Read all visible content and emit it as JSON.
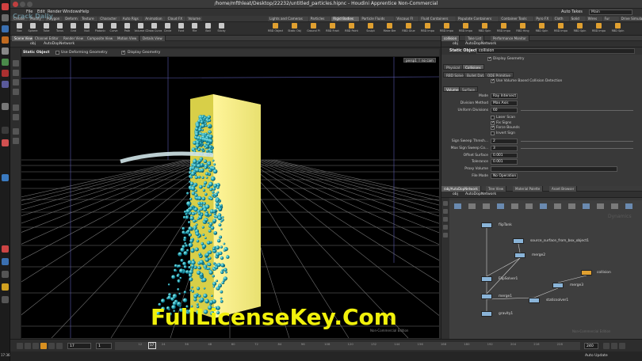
{
  "window": {
    "title": "/home/mfthleat/Desktop/22232/untitled_particles.hipnc - Houdini Apprentice Non-Commercial"
  },
  "menu": [
    "File",
    "Edit",
    "Render",
    "Windows",
    "Help"
  ],
  "desktop_switch": {
    "label": "Auto Takes",
    "value": "Main"
  },
  "shelf_tabs": [
    {
      "label": "Create",
      "active": false
    },
    {
      "label": "Modify",
      "active": false
    },
    {
      "label": "Polygon",
      "active": false
    },
    {
      "label": "Deform",
      "active": false
    },
    {
      "label": "Texture",
      "active": false
    },
    {
      "label": "Character",
      "active": false
    },
    {
      "label": "Auto Rigs",
      "active": false
    },
    {
      "label": "Animation",
      "active": false
    },
    {
      "label": "Cloud FX",
      "active": false
    },
    {
      "label": "Volume",
      "active": false
    },
    {
      "label": "Lights and Cameras",
      "active": false
    },
    {
      "label": "Particles",
      "active": false
    },
    {
      "label": "Rigid Bodies",
      "active": true
    },
    {
      "label": "Particle Fluids",
      "active": false
    },
    {
      "label": "Viscous Fl",
      "active": false
    },
    {
      "label": "Fluid Containers",
      "active": false
    },
    {
      "label": "Populate Containers",
      "active": false
    },
    {
      "label": "Container Tools",
      "active": false
    },
    {
      "label": "Pyro FX",
      "active": false
    },
    {
      "label": "Cloth",
      "active": false
    },
    {
      "label": "Solid",
      "active": false
    },
    {
      "label": "Wires",
      "active": false
    },
    {
      "label": "Fur",
      "active": false
    },
    {
      "label": "Drive Simulation",
      "active": false
    }
  ],
  "shelf_tools": [
    {
      "label": "Box",
      "color": "#c9c9c9"
    },
    {
      "label": "Sphere",
      "color": "#c9c9c9"
    },
    {
      "label": "Tube",
      "color": "#c9c9c9"
    },
    {
      "label": "Torus",
      "color": "#c9c9c9"
    },
    {
      "label": "Grid",
      "color": "#c9c9c9"
    },
    {
      "label": "Null",
      "color": "#c9c9c9"
    },
    {
      "label": "Platonic",
      "color": "#c9c9c9"
    },
    {
      "label": "Curve",
      "color": "#c9c9c9"
    },
    {
      "label": "Path",
      "color": "#c9c9c9"
    },
    {
      "label": "Volume C",
      "color": "#c9c9c9"
    },
    {
      "label": "Draw Curve",
      "color": "#c9c9c9"
    },
    {
      "label": "Circle",
      "color": "#c9c9c9"
    },
    {
      "label": "Font",
      "color": "#c9c9c9"
    },
    {
      "label": "File",
      "color": "#c9c9c9"
    },
    {
      "label": "Ball",
      "color": "#c9c9c9"
    },
    {
      "label": "Sticky",
      "color": "#c9c9c9"
    },
    {
      "label": "RBD Object",
      "color": "#e0a030"
    },
    {
      "label": "Static Obj",
      "color": "#e0a030"
    },
    {
      "label": "Ground Pl",
      "color": "#e0a030"
    },
    {
      "label": "RBD Fract",
      "color": "#e0a030"
    },
    {
      "label": "RBD Point",
      "color": "#e0a030"
    },
    {
      "label": "Sculpt",
      "color": "#e0a030"
    },
    {
      "label": "Make Bre",
      "color": "#e0a030"
    },
    {
      "label": "RBD Glue",
      "color": "#e0a030"
    },
    {
      "label": "RBD Impo",
      "color": "#e0a030"
    },
    {
      "label": "RBD Impo",
      "color": "#e0a030"
    },
    {
      "label": "RBD Impo",
      "color": "#e0a030"
    },
    {
      "label": "RBD Spin",
      "color": "#e0a030"
    },
    {
      "label": "RBD Impo",
      "color": "#e0a030"
    },
    {
      "label": "RBD Hing",
      "color": "#e0a030"
    },
    {
      "label": "RBD Spin",
      "color": "#e0a030"
    },
    {
      "label": "RBD Impo",
      "color": "#e0a030"
    },
    {
      "label": "RBD Spin",
      "color": "#e0a030"
    },
    {
      "label": "RBD Impo",
      "color": "#e0a030"
    },
    {
      "label": "RBD Spin",
      "color": "#e0a030"
    }
  ],
  "left_pane": {
    "tabs": [
      {
        "label": "Scene View",
        "active": true
      },
      {
        "label": "Channel Editor",
        "active": false
      },
      {
        "label": "Render View",
        "active": false
      },
      {
        "label": "Composite View",
        "active": false
      },
      {
        "label": "Motion View",
        "active": false
      },
      {
        "label": "Details View",
        "active": false
      }
    ],
    "path": "obj",
    "network": "AutoDopNetwork",
    "viewport_bar": {
      "object_type": "Static Object",
      "deforming": "Use Deforming Geometry",
      "display": "Display Geometry"
    },
    "view_labels": {
      "persp": "persp1",
      "cam": "no cam"
    },
    "corner_label": "Non-Commercial Edition"
  },
  "param_pane": {
    "tabs": [
      {
        "label": "collision",
        "active": true
      },
      {
        "label": "Take List",
        "active": false
      },
      {
        "label": "Performance Monitor",
        "active": false
      }
    ],
    "node_type": "Static Object",
    "node_name": "collision",
    "display_geometry": "Display Geometry",
    "top_tabs": [
      {
        "label": "Physical",
        "active": false
      },
      {
        "label": "Collisions",
        "active": true
      }
    ],
    "sub_tabs": [
      {
        "label": "RBD Solver",
        "active": false
      },
      {
        "label": "Bullet Data",
        "active": false
      },
      {
        "label": "ODE Primitive",
        "active": false
      }
    ],
    "volume_collision": "Use Volume Based Collision Detection",
    "vol_tabs": [
      {
        "label": "Volume",
        "active": true
      },
      {
        "label": "Surface",
        "active": false
      }
    ],
    "params": [
      {
        "label": "Mode",
        "value": "Ray Intersect"
      },
      {
        "label": "Division Method",
        "value": "Max Axis"
      },
      {
        "label": "Uniform Divisions",
        "value": "60"
      }
    ],
    "checks": [
      {
        "label": "Laser Scan",
        "on": false
      },
      {
        "label": "Fix Signs",
        "on": true
      },
      {
        "label": "Force Bounds",
        "on": true
      },
      {
        "label": "Invert Sign",
        "on": false
      }
    ],
    "params2": [
      {
        "label": "Sign Sweep Thresh...",
        "value": "2"
      },
      {
        "label": "Max Sign Sweep Co...",
        "value": "3"
      },
      {
        "label": "Offset Surface",
        "value": "0.001"
      },
      {
        "label": "Tolerance",
        "value": "0.001"
      },
      {
        "label": "Proxy Volume",
        "value": ""
      },
      {
        "label": "File Mode",
        "value": "No Operation"
      }
    ]
  },
  "net_pane": {
    "tabs": [
      {
        "label": "/obj/AutoDopNetwork",
        "active": true
      },
      {
        "label": "Tree View",
        "active": false
      },
      {
        "label": "Material Palette",
        "active": false
      },
      {
        "label": "Asset Browser",
        "active": false
      }
    ],
    "path": "obj",
    "network": "AutoDopNetwork",
    "context": "Dynamics",
    "nodes": [
      {
        "name": "flipTank",
        "color": "#8ab4d8"
      },
      {
        "name": "source_surface_from_box_object1",
        "color": "#8ab4d8"
      },
      {
        "name": "merge2",
        "color": "#8ab4d8"
      },
      {
        "name": "collision",
        "color": "#e0a030"
      },
      {
        "name": "FlipSolver1",
        "color": "#8ab4d8"
      },
      {
        "name": "merge3",
        "color": "#8ab4d8"
      },
      {
        "name": "merge1",
        "color": "#8ab4d8"
      },
      {
        "name": "staticsolver1",
        "color": "#8ab4d8"
      },
      {
        "name": "gravity1",
        "color": "#8ab4d8"
      }
    ],
    "watermark": "Non-Commercial Edition"
  },
  "timeline": {
    "current_frame": "17",
    "start_frame": "1",
    "end_frame": "240",
    "ticks": [
      "12",
      "24",
      "36",
      "48",
      "60",
      "72",
      "84",
      "96",
      "108",
      "120",
      "132",
      "144",
      "156",
      "168",
      "180",
      "192",
      "204",
      "216",
      "228"
    ],
    "auto_update": "Auto Update",
    "frame_marker": "17"
  },
  "watermark_overlay": "FullLicenseKey.Com",
  "logo_overlay": "Crack Daily",
  "clock": "17:36"
}
